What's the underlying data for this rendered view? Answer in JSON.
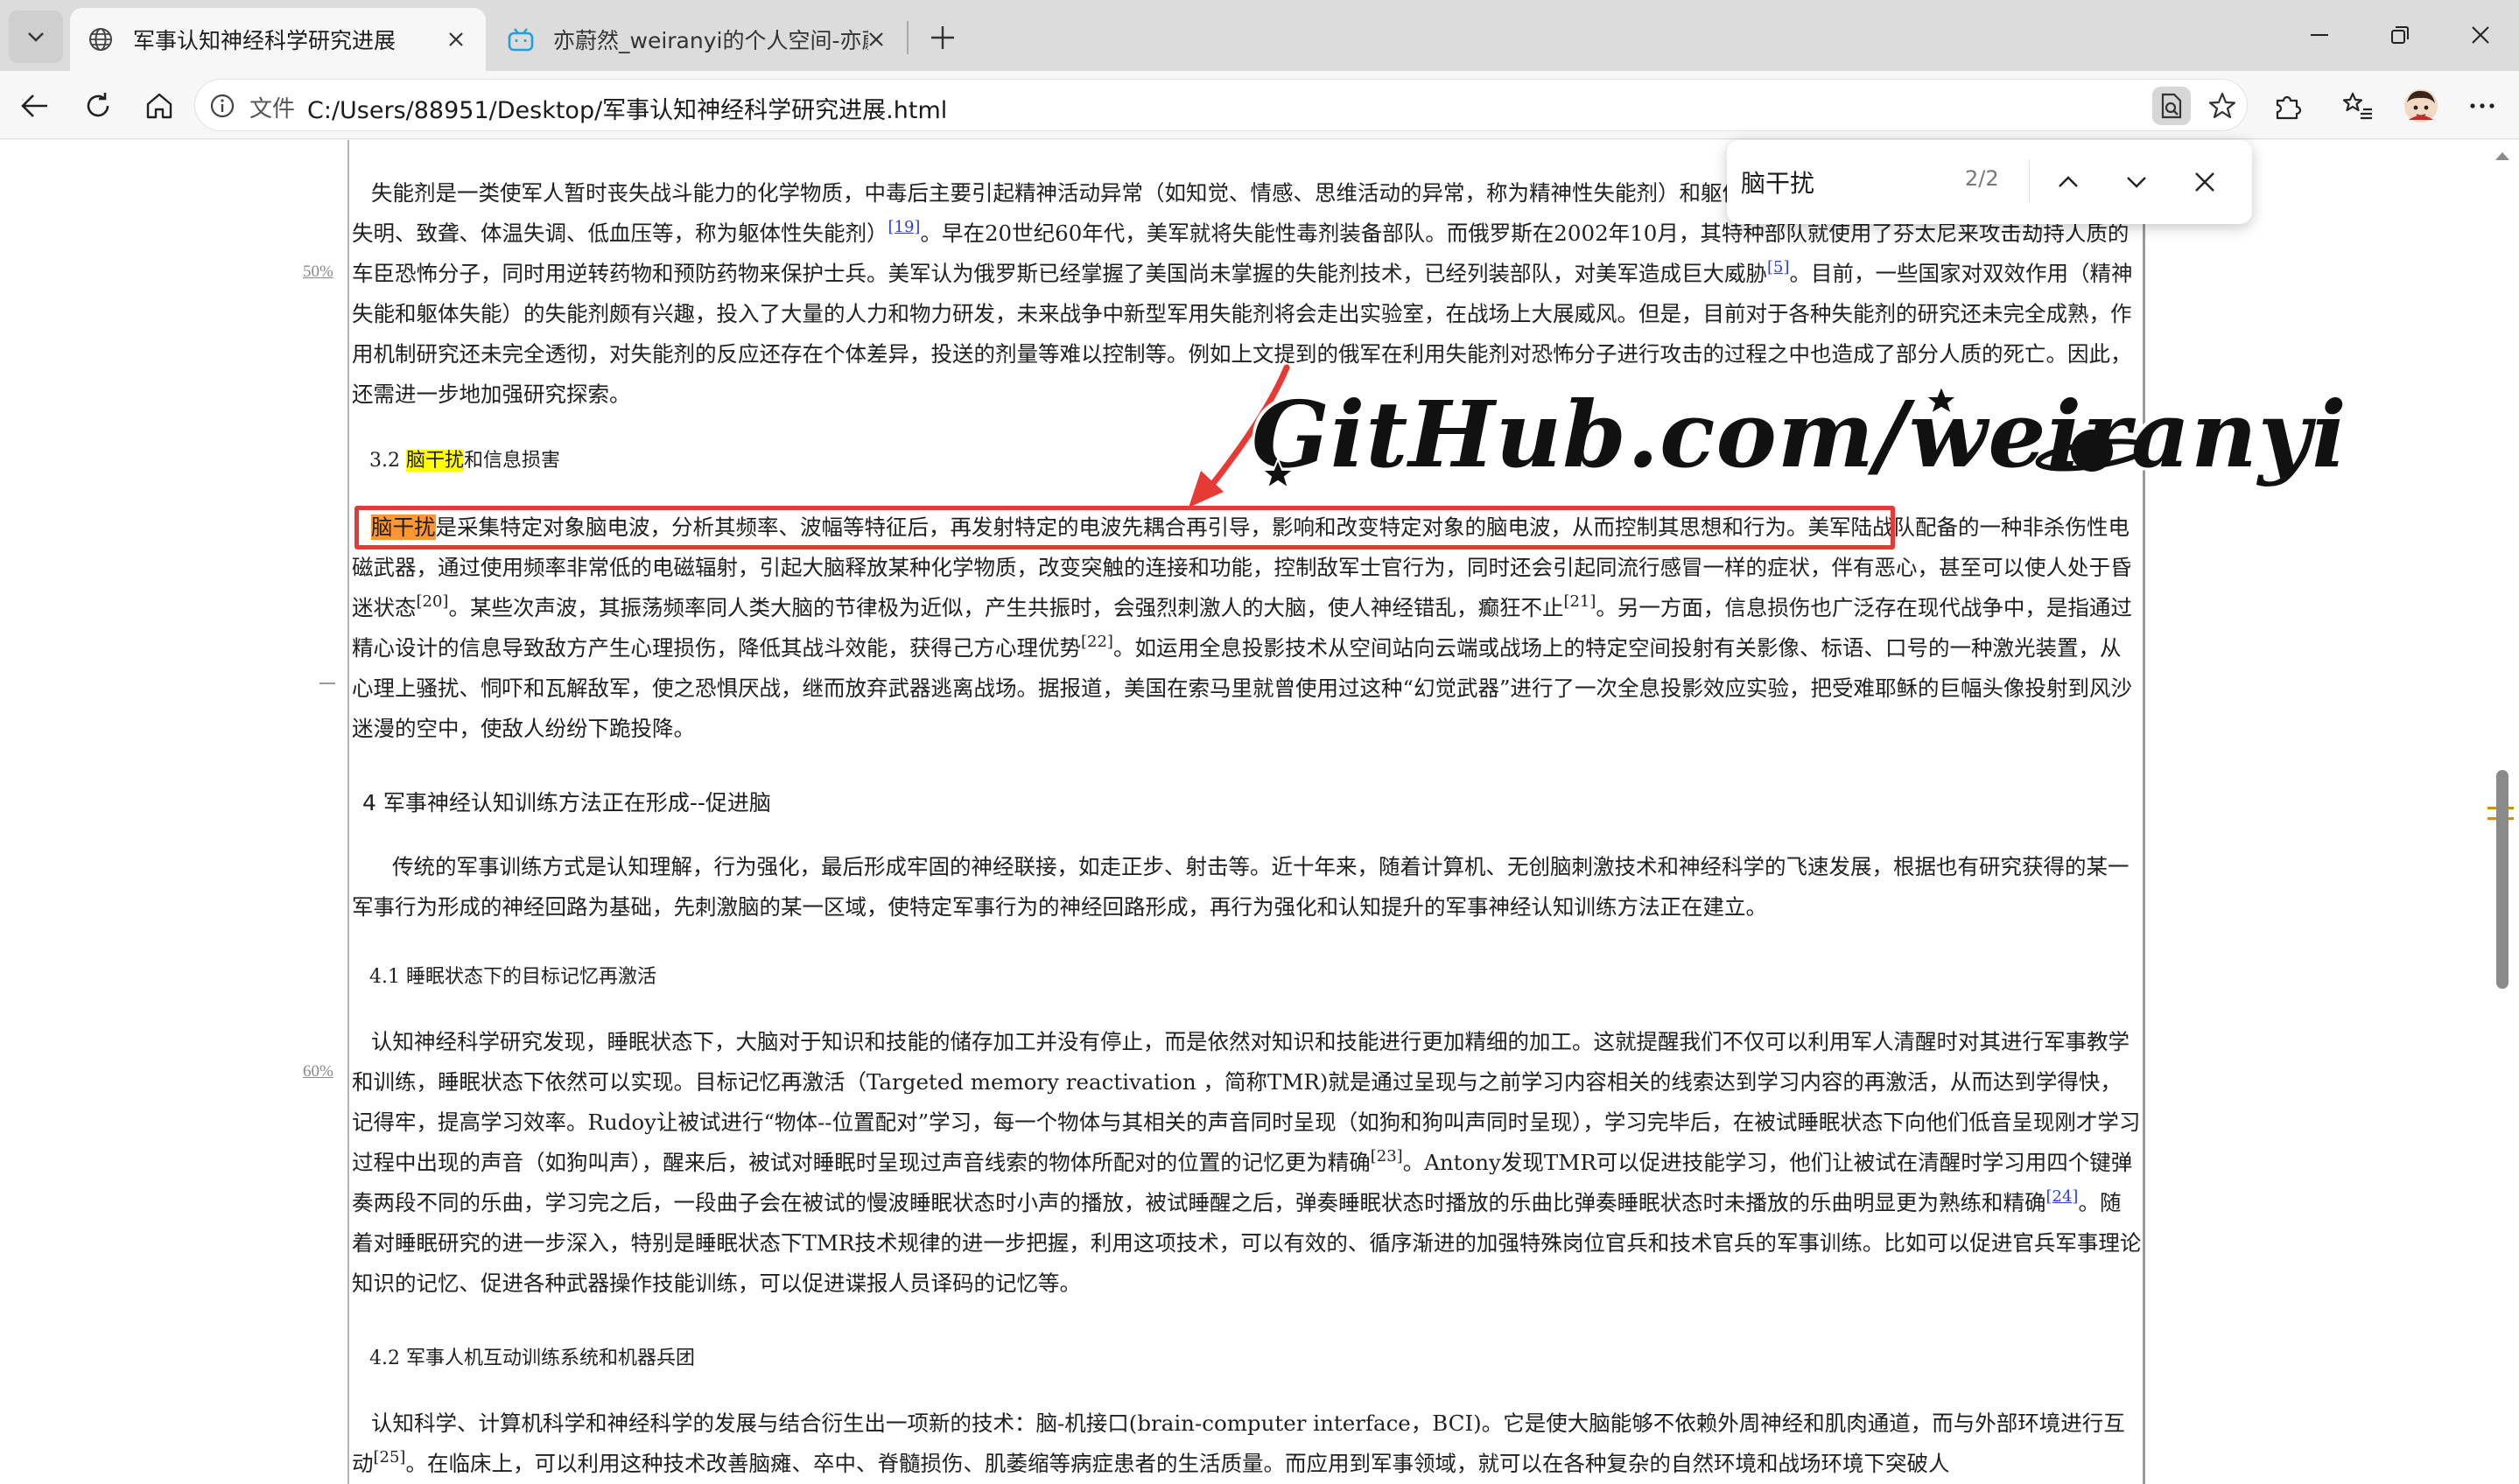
{
  "browser": {
    "tabs": [
      {
        "title": "军事认知神经科学研究进展",
        "active": true
      },
      {
        "title": "亦蔚然_weiranyi的个人空间-亦蔚然",
        "active": false
      }
    ],
    "scheme_label": "文件",
    "url": "C:/Users/88951/Desktop/军事认知神经科学研究进展.html",
    "accent": "#e83a35"
  },
  "findbar": {
    "query": "脑干扰",
    "count": "2/2"
  },
  "margin_notes": [
    "50%",
    "60%"
  ],
  "watermark": "GitHub.com/weiranyi",
  "document": {
    "para1": {
      "text1": "失能剂是一类使军人暂时丧失战斗能力的化学物质，中毒后主要引起精神活动异常（如知觉、情感、思维活动的异常，称为精神性失能剂）和躯体功能障碍（如运动障碍、瘫痪以及呕吐、失明、致聋、体温失调、低血压等，称为躯体性失能剂）",
      "ref1": "[19]",
      "text2": "。早在20世纪60年代，美军就将失能性毒剂装备部队。而俄罗斯在2002年10月，其特种部队就使用了芬太尼来攻击劫持人质的车臣恐怖分子，同时用逆转药物和预防药物来保护士兵。美军认为俄罗斯已经掌握了美国尚未掌握的失能剂技术，已经列装部队，对美军造成巨大威胁",
      "ref2": "[5]",
      "text3": "。目前，一些国家对双效作用（精神失能和躯体失能）的失能剂颇有兴趣，投入了大量的人力和物力研发，未来战争中新型军用失能剂将会走出实验室，在战场上大展威风。但是，目前对于各种失能剂的研究还未完全成熟，作用机制研究还未完全透彻，对失能剂的反应还存在个体差异，投送的剂量等难以控制等。例如上文提到的俄军在利用失能剂对恐怖分子进行攻击的过程之中也造成了部分人质的死亡。因此，还需进一步地加强研究探索。"
    },
    "h32": {
      "num": "3.2 ",
      "hl": "脑干扰",
      "rest": "和信息损害"
    },
    "para2": {
      "hl": "脑干扰",
      "text1": "是采集特定对象脑电波，分析其频率、波幅等特征后，再发射特定的电波先耦合再引导，影响和改变特定对象的脑电波，从而控制其思想和行为。美军陆战队配备的一种非杀伤性电磁武器，通过使用频率非常低的电磁辐射，引起大脑释放某种化学物质，改变突触的连接和功能，控制敌军士官行为，同时还会引起同流行感冒一样的症状，伴有恶心，甚至可以使人处于昏迷状态",
      "ref1": "[20]",
      "text2": "。某些次声波，其振荡频率同人类大脑的节律极为近似，产生共振时，会强烈刺激人的大脑，使人神经错乱，癫狂不止",
      "ref2": "[21]",
      "text3": "。另一方面，信息损伤也广泛存在现代战争中，是指通过精心设计的信息导致敌方产生心理损伤，降低其战斗效能，获得己方心理优势",
      "ref3": "[22]",
      "text4": "。如运用全息投影技术从空间站向云端或战场上的特定空间投射有关影像、标语、口号的一种激光装置，从心理上骚扰、恫吓和瓦解敌军，使之恐惧厌战，继而放弃武器逃离战场。据报道，美国在索马里就曾使用过这种“幻觉武器”进行了一次全息投影效应实验，把受难耶稣的巨幅头像投射到风沙迷漫的空中，使敌人纷纷下跪投降。"
    },
    "h4": "4 军事神经认知训练方法正在形成--促进脑",
    "para3": "传统的军事训练方式是认知理解，行为强化，最后形成牢固的神经联接，如走正步、射击等。近十年来，随着计算机、无创脑刺激技术和神经科学的飞速发展，根据也有研究获得的某一军事行为形成的神经回路为基础，先刺激脑的某一区域，使特定军事行为的神经回路形成，再行为强化和认知提升的军事神经认知训练方法正在建立。",
    "h41": "4.1 睡眠状态下的目标记忆再激活",
    "para4": {
      "text1": "认知神经科学研究发现，睡眠状态下，大脑对于知识和技能的储存加工并没有停止，而是依然对知识和技能进行更加精细的加工。这就提醒我们不仅可以利用军人清醒时对其进行军事教学和训练，睡眠状态下依然可以实现。目标记忆再激活（Targeted memory reactivation ，简称TMR)就是通过呈现与之前学习内容相关的线索达到学习内容的再激活，从而达到学得快，记得牢，提高学习效率。Rudoy让被试进行“物体--位置配对”学习，每一个物体与其相关的声音同时呈现（如狗和狗叫声同时呈现），学习完毕后，在被试睡眠状态下向他们低音呈现刚才学习过程中出现的声音（如狗叫声），醒来后，被试对睡眠时呈现过声音线索的物体所配对的位置的记忆更为精确",
      "ref1": "[23]",
      "text2": "。Antony发现TMR可以促进技能学习，他们让被试在清醒时学习用四个键弹奏两段不同的乐曲，学习完之后，一段曲子会在被试的慢波睡眠状态时小声的播放，被试睡醒之后，弹奏睡眠状态时播放的乐曲比弹奏睡眠状态时未播放的乐曲明显更为熟练和精确",
      "ref2": "[24]",
      "text3": "。随着对睡眠研究的进一步深入，特别是睡眠状态下TMR技术规律的进一步把握，利用这项技术，可以有效的、循序渐进的加强特殊岗位官兵和技术官兵的军事训练。比如可以促进官兵军事理论知识的记忆、促进各种武器操作技能训练，可以促进谍报人员译码的记忆等。"
    },
    "h42": "4.2 军事人机互动训练系统和机器兵团",
    "para5": {
      "text1": "认知科学、计算机科学和神经科学的发展与结合衍生出一项新的技术：脑-机接口(brain-computer interface，BCI)。它是使大脑能够不依赖外周神经和肌肉通道，而与外部环境进行互动",
      "ref1": "[25]",
      "text2": "。在临床上，可以利用这种技术改善脑瘫、卒中、脊髓损伤、肌萎缩等病症患者的生活质量。而应用到军事领域，就可以在各种复杂的自然环境和战场环境下突破人"
    }
  }
}
